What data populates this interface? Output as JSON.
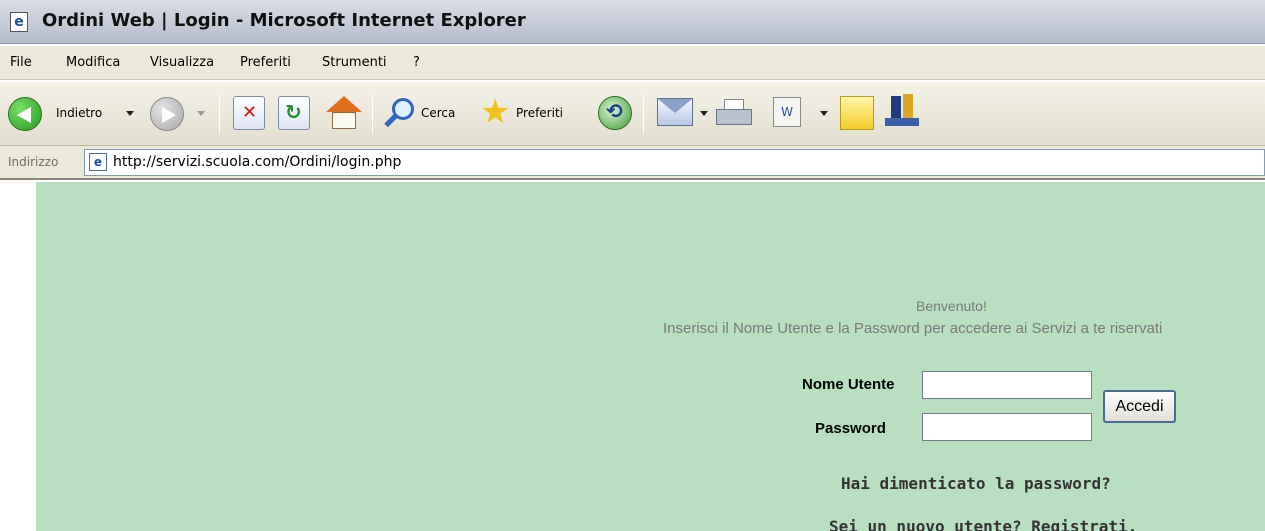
{
  "window": {
    "title": "Ordini Web | Login - Microsoft Internet Explorer",
    "app_icon": "ie-page-icon"
  },
  "menu": {
    "items": [
      "File",
      "Modifica",
      "Visualizza",
      "Preferiti",
      "Strumenti",
      "?"
    ]
  },
  "toolbar": {
    "back_label": "Indietro",
    "search_label": "Cerca",
    "favorites_label": "Preferiti",
    "icons": [
      "back-arrow-icon",
      "forward-arrow-icon",
      "stop-icon",
      "refresh-icon",
      "home-icon",
      "search-icon",
      "favorites-star-icon",
      "history-icon",
      "mail-icon",
      "print-icon",
      "edit-word-icon",
      "note-icon",
      "research-icon"
    ]
  },
  "address": {
    "label": "Indirizzo",
    "url": "http://servizi.scuola.com/Ordini/login.php",
    "highlight_color": "#d80c0c"
  },
  "page": {
    "background_color": "#b7dfc0",
    "welcome": "Benvenuto!",
    "instruction": "Inserisci il Nome Utente e la Password per accedere ai Servizi a te riservati",
    "username_label": "Nome Utente",
    "password_label": "Password",
    "username_value": "",
    "password_value": "",
    "submit_label": "Accedi",
    "forgot_link": "Hai dimenticato la password?",
    "register_link": "Sei un nuovo utente? Registrati."
  }
}
